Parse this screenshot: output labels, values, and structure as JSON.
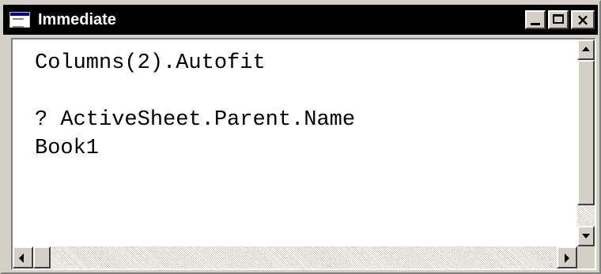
{
  "window": {
    "title": "Immediate",
    "icon": "immediate-window-icon"
  },
  "titlebar_buttons": {
    "minimize": "minimize-icon",
    "maximize": "maximize-icon",
    "close": "×"
  },
  "editor": {
    "lines": [
      "Columns(2).Autofit",
      "? ActiveSheet.Parent.Name",
      "Book1"
    ]
  },
  "colors": {
    "titlebar": "#000000",
    "chrome": "#d4d0c8",
    "editor_bg": "#ffffff"
  }
}
